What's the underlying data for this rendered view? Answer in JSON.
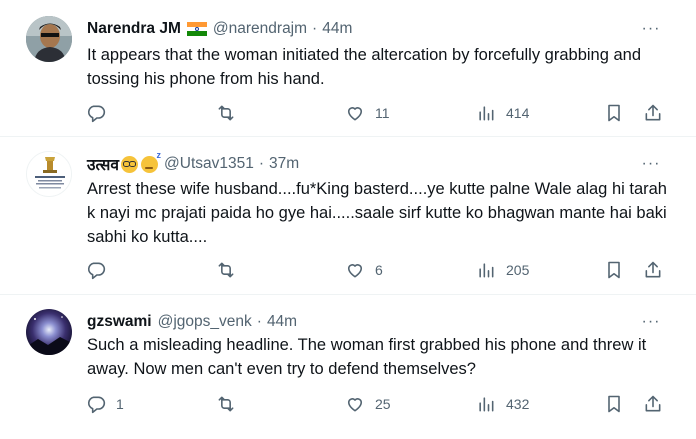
{
  "tweets": [
    {
      "name": "Narendra JM",
      "handle": "@narendrajm",
      "separator": "·",
      "time": "44m",
      "more": "···",
      "text": "It appears that the woman initiated the altercation by forcefully grabbing and tossing his phone from his hand.",
      "replies": "",
      "retweets": "",
      "likes": "11",
      "views": "414",
      "badge": "india-flag-icon"
    },
    {
      "name": "उत्सव",
      "handle": "@Utsav1351",
      "separator": "·",
      "time": "37m",
      "more": "···",
      "text": "Arrest these wife husband....fu*King basterd....ye kutte palne Wale alag hi tarah k nayi mc prajati paida ho gye hai.....saale sirf kutte ko bhagwan mante hai baki sabhi ko kutta....",
      "replies": "",
      "retweets": "",
      "likes": "6",
      "views": "205",
      "badge": "nerd-face-emoji, sleeping-face-emoji"
    },
    {
      "name": "gzswami",
      "handle": "@jgops_venk",
      "separator": "·",
      "time": "44m",
      "more": "···",
      "text": "Such a misleading headline. The woman first grabbed his phone and threw it away.  Now men can't even try to defend themselves?",
      "replies": "1",
      "retweets": "",
      "likes": "25",
      "views": "432",
      "badge": ""
    }
  ],
  "colors": {
    "text": "#0f1419",
    "secondary": "#536471",
    "divider": "#eff3f4"
  }
}
